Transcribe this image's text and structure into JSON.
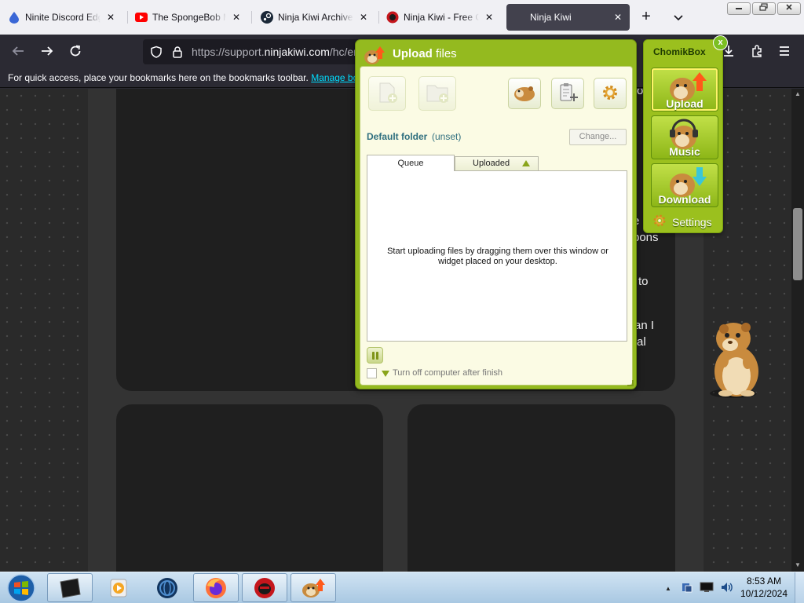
{
  "browser": {
    "tabs": [
      {
        "title": "Ninite Discord Edge",
        "icon": "ninite-icon",
        "active": false
      },
      {
        "title": "The SpongeBob Mo",
        "icon": "youtube-icon",
        "active": false
      },
      {
        "title": "Ninja Kiwi Archive",
        "icon": "steam-icon",
        "active": false
      },
      {
        "title": "Ninja Kiwi - Free Or",
        "icon": "ninjakiwi-icon",
        "active": false
      },
      {
        "title": "Ninja Kiwi",
        "icon": "none",
        "active": true
      }
    ],
    "tab_close_glyph": "✕",
    "new_tab_glyph": "+",
    "list_tabs_glyph": "⌄",
    "url_prefix": "https://support.",
    "url_domain": "ninjakiwi.com",
    "url_suffix": "/hc/en",
    "bookmarks_message": "For quick access, place your bookmarks here on the bookmarks toolbar.",
    "bookmarks_link": "Manage bookmarks…"
  },
  "page": {
    "text_fragments": [
      "o",
      "e",
      "pons",
      "to",
      "an I",
      "al"
    ]
  },
  "upload_window": {
    "title_bold": "Upload",
    "title_rest": " files",
    "default_folder_label": "Default folder",
    "default_folder_value": "(unset)",
    "change_button": "Change...",
    "tab_queue": "Queue",
    "tab_uploaded": "Uploaded",
    "queue_message": "Start uploading files by dragging them over this window or widget placed on your desktop.",
    "turn_off_label": "Turn off computer after finish"
  },
  "chomikbox": {
    "title": "ChomikBox",
    "close_glyph": "x",
    "buttons": [
      {
        "label": "Upload",
        "icon": "hamster-upload-icon",
        "selected": true
      },
      {
        "label": "Music",
        "icon": "hamster-music-icon",
        "selected": false
      },
      {
        "label": "Download",
        "icon": "hamster-download-icon",
        "selected": false
      }
    ],
    "settings_label": "Settings"
  },
  "taskbar": {
    "apps": [
      "windows-start",
      "generic-black-app",
      "media-player",
      "globe-app",
      "firefox",
      "ninjakiwi",
      "chomikbox"
    ],
    "time": "8:53 AM",
    "date": "10/12/2024",
    "tray_arrow": "▲"
  },
  "colors": {
    "chomik_green": "#94ba1f",
    "firefox_toolbar": "#2b2a33",
    "link_cyan": "#00ddff"
  }
}
